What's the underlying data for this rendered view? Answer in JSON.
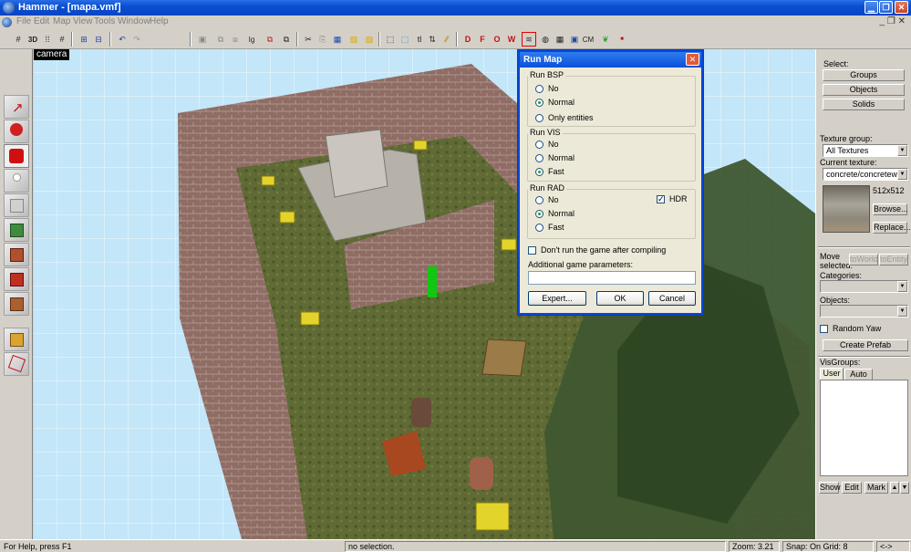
{
  "window": {
    "title": "Hammer - [mapa.vmf]"
  },
  "menu": [
    "File",
    "Edit",
    "Map",
    "View",
    "Tools",
    "Window",
    "Help"
  ],
  "toolbar": {
    "cm_label": "CM"
  },
  "viewport": {
    "label": "camera"
  },
  "dialog": {
    "title": "Run Map",
    "close_glyph": "✕",
    "bsp": {
      "label": "Run BSP",
      "options": [
        "No",
        "Normal",
        "Only entities"
      ],
      "selected": "Normal"
    },
    "vis": {
      "label": "Run VIS",
      "options": [
        "No",
        "Normal",
        "Fast"
      ],
      "selected": "Fast"
    },
    "rad": {
      "label": "Run RAD",
      "options": [
        "No",
        "Normal",
        "Fast"
      ],
      "selected": "Normal",
      "hdr_label": "HDR",
      "hdr_checked": true
    },
    "dont_run_label": "Don't run the game after compiling",
    "dont_run_checked": false,
    "params_label": "Additional game parameters:",
    "params_value": "",
    "expert_label": "Expert...",
    "ok_label": "OK",
    "cancel_label": "Cancel"
  },
  "rpanel": {
    "select_label": "Select:",
    "groups_btn": "Groups",
    "objects_btn": "Objects",
    "solids_btn": "Solids",
    "texture_group_label": "Texture group:",
    "texture_group_value": "All Textures",
    "current_texture_label": "Current texture:",
    "current_texture_value": "concrete/concretewall(",
    "texture_size": "512x512",
    "browse_btn": "Browse...",
    "replace_btn": "Replace...",
    "move_selected_label": "Move selected:",
    "to_world_btn": "toWorld",
    "to_entity_btn": "toEntity",
    "categories_label": "Categories:",
    "objects_label": "Objects:",
    "random_yaw_label": "Random Yaw",
    "create_prefab_btn": "Create Prefab",
    "visgroups_label": "VisGroups:",
    "tab_user": "User",
    "tab_auto": "Auto",
    "show_btn": "Show",
    "edit_btn": "Edit",
    "mark_btn": "Mark",
    "up_glyph": "▲",
    "down_glyph": "▼"
  },
  "status": {
    "help": "For Help, press F1",
    "selection": "no selection.",
    "zoom": "Zoom: 3.21",
    "snap": "Snap: On Grid: 8",
    "arrows": "<->"
  }
}
